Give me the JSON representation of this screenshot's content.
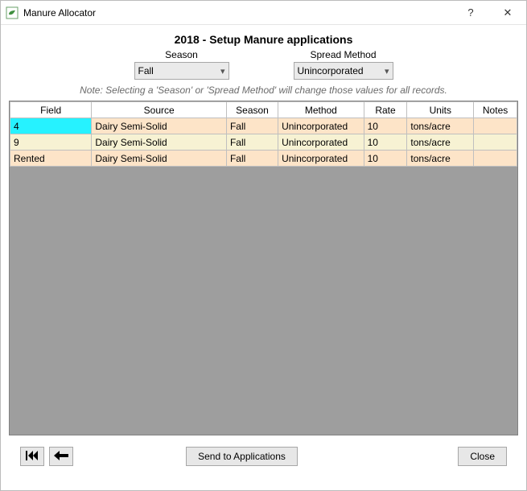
{
  "window": {
    "title": "Manure Allocator",
    "help_glyph": "?",
    "close_glyph": "✕"
  },
  "heading": "2018 - Setup Manure applications",
  "selectors": {
    "season": {
      "label": "Season",
      "value": "Fall"
    },
    "method": {
      "label": "Spread Method",
      "value": "Unincorporated"
    }
  },
  "note": "Note: Selecting a 'Season' or 'Spread Method' will change those values for all records.",
  "grid": {
    "columns": [
      "Field",
      "Source",
      "Season",
      "Method",
      "Rate",
      "Units",
      "Notes"
    ],
    "rows": [
      {
        "field": "4",
        "source": "Dairy Semi-Solid",
        "season": "Fall",
        "method": "Unincorporated",
        "rate": "10",
        "units": "tons/acre",
        "notes": "",
        "selected": true
      },
      {
        "field": "9",
        "source": "Dairy Semi-Solid",
        "season": "Fall",
        "method": "Unincorporated",
        "rate": "10",
        "units": "tons/acre",
        "notes": "",
        "selected": false
      },
      {
        "field": "Rented",
        "source": "Dairy Semi-Solid",
        "season": "Fall",
        "method": "Unincorporated",
        "rate": "10",
        "units": "tons/acre",
        "notes": "",
        "selected": false
      }
    ]
  },
  "footer": {
    "send_label": "Send to Applications",
    "close_label": "Close"
  },
  "icons": {
    "first": "I◄◄",
    "undo": "◄━"
  }
}
